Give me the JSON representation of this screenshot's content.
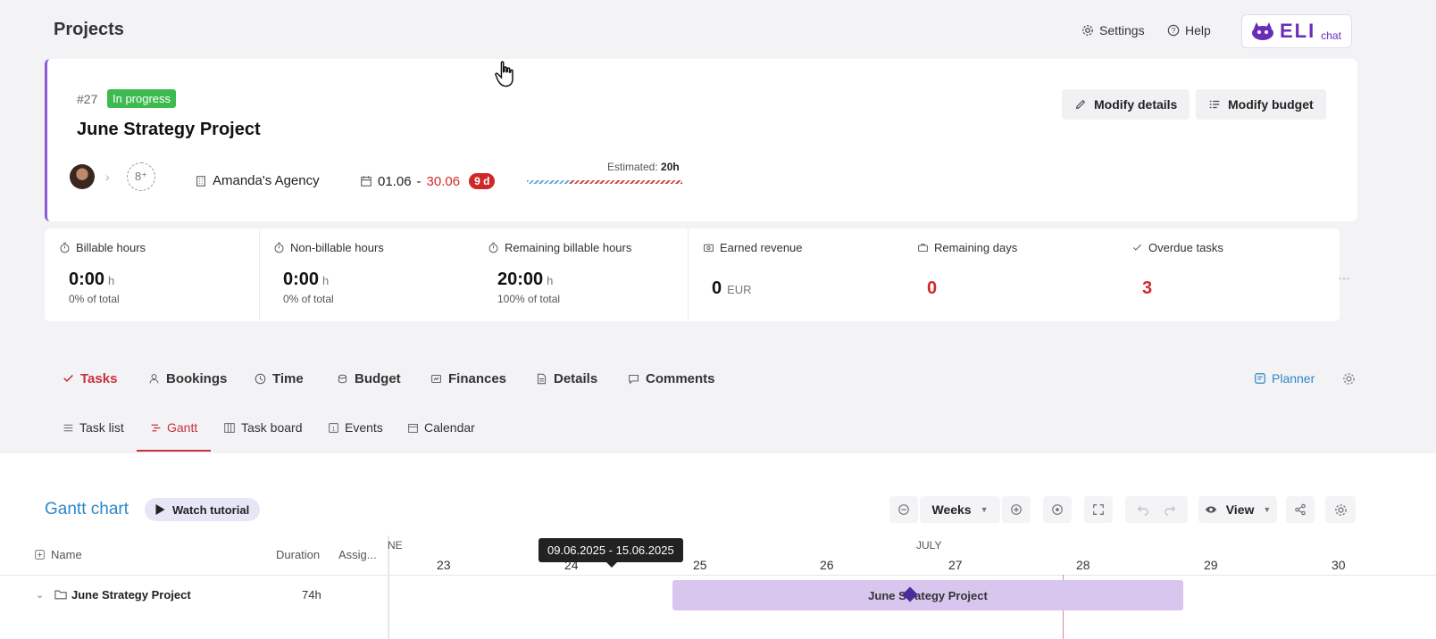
{
  "header": {
    "title": "Projects",
    "settings_label": "Settings",
    "help_label": "Help",
    "chat_logo": {
      "word": "ELI",
      "suffix": "chat"
    }
  },
  "project": {
    "number": "#27",
    "status": "In progress",
    "status_color": "#3dbb50",
    "title": "June Strategy Project",
    "modify_details_label": "Modify details",
    "modify_budget_label": "Modify budget",
    "add_user_glyph": "8⁺",
    "client": "Amanda's Agency",
    "date_start": "01.06",
    "date_sep": "-",
    "date_end": "30.06",
    "days_badge": "9 d",
    "estimated_label": "Estimated:",
    "estimated_value": "20h",
    "accent_color": "#8c5ad6"
  },
  "stats": [
    {
      "label": "Billable hours",
      "value": "0:00",
      "unit": "h",
      "sub": "0% of total"
    },
    {
      "label": "Non-billable hours",
      "value": "0:00",
      "unit": "h",
      "sub": "0% of total"
    },
    {
      "label": "Remaining billable hours",
      "value": "20:00",
      "unit": "h",
      "sub": "100% of total"
    },
    {
      "label": "Earned revenue",
      "value": "0",
      "unit": "EUR"
    },
    {
      "label": "Remaining days",
      "value": "0"
    },
    {
      "label": "Overdue tasks",
      "value": "3"
    }
  ],
  "more_label": "…",
  "tabs": [
    {
      "label": "Tasks",
      "active": true
    },
    {
      "label": "Bookings"
    },
    {
      "label": "Time"
    },
    {
      "label": "Budget"
    },
    {
      "label": "Finances"
    },
    {
      "label": "Details"
    },
    {
      "label": "Comments"
    }
  ],
  "planner_label": "Planner",
  "sub_tabs": [
    {
      "label": "Task list"
    },
    {
      "label": "Gantt",
      "active": true
    },
    {
      "label": "Task board"
    },
    {
      "label": "Events"
    },
    {
      "label": "Calendar"
    }
  ],
  "gantt": {
    "title": "Gantt chart",
    "watch_tutorial_label": "Watch tutorial",
    "zoom_unit": "Weeks",
    "view_label": "View",
    "columns": {
      "name": "Name",
      "duration": "Duration",
      "assignee": "Assig..."
    },
    "months": {
      "june_fragment": "NE",
      "july": "JULY"
    },
    "weeks": [
      "23",
      "24",
      "25",
      "26",
      "27",
      "28",
      "29",
      "30"
    ],
    "tooltip": "09.06.2025 - 15.06.2025",
    "row": {
      "name": "June Strategy Project",
      "duration": "74h",
      "bar_label": "June Strategy Project"
    }
  }
}
